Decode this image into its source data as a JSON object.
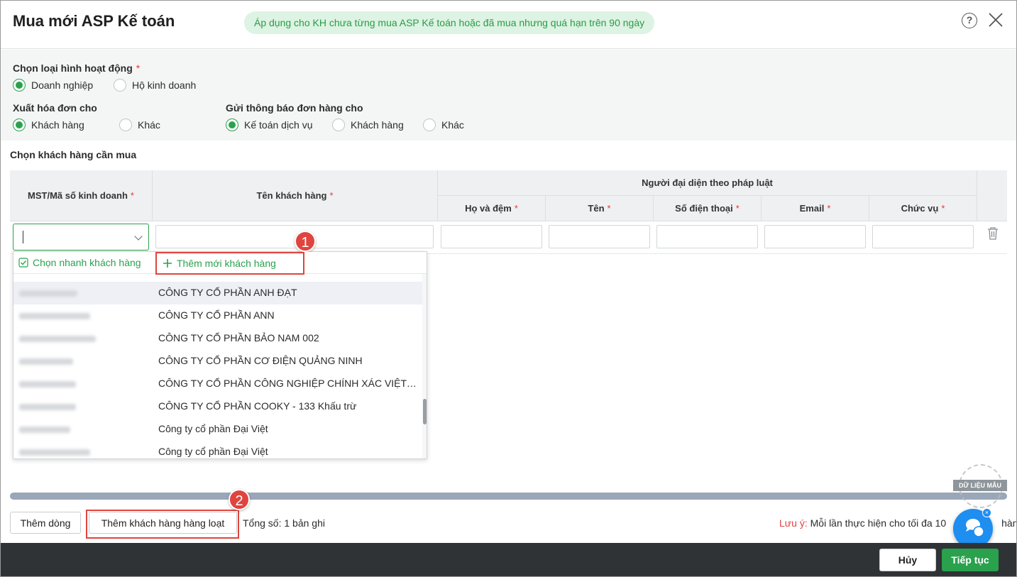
{
  "header": {
    "title": "Mua mới ASP Kế toán",
    "notice": "Áp dụng cho KH chưa từng mua ASP Kế toán hoặc đã mua nhưng quá hạn trên 90 ngày",
    "help_icon": "?"
  },
  "options": {
    "activity_type": {
      "label": "Chọn loại hình hoạt động",
      "required_mark": "*",
      "choices": [
        "Doanh nghiệp",
        "Hộ kinh doanh"
      ],
      "selected": "Doanh nghiệp"
    },
    "invoice_for": {
      "label": "Xuất hóa đơn cho",
      "choices": [
        "Khách hàng",
        "Khác"
      ],
      "selected": "Khách hàng"
    },
    "notify_for": {
      "label": "Gửi thông báo đơn hàng cho",
      "choices": [
        "Kế toán dịch vụ",
        "Khách hàng",
        "Khác"
      ],
      "selected": "Kế toán dịch vụ"
    }
  },
  "customers": {
    "section_title": "Chọn khách hàng cần mua",
    "columns": {
      "mst": "MST/Mã số kinh doanh",
      "name": "Tên khách hàng",
      "representative_group": "Người đại diện theo pháp luật",
      "last_middle": "Họ và đệm",
      "first": "Tên",
      "phone": "Số điện thoại",
      "email": "Email",
      "position": "Chức vụ"
    },
    "required_mark": "*"
  },
  "dropdown": {
    "quick_select": "Chọn nhanh khách hàng",
    "add_new": "Thêm mới khách hàng",
    "items": [
      {
        "name": "CÔNG TY CỔ PHẦN ANH ĐẠT"
      },
      {
        "name": "CÔNG TY CỔ PHẦN ANN"
      },
      {
        "name": "CÔNG TY CỔ PHẦN BẢO NAM 002"
      },
      {
        "name": "CÔNG TY CỔ PHẦN CƠ ĐIỆN QUẢNG NINH"
      },
      {
        "name": "CÔNG TY CỔ PHẦN CÔNG NGHIỆP CHÍNH XÁC VIỆT NAM"
      },
      {
        "name": "CÔNG TY CỔ PHẦN COOKY - 133 Khấu trừ"
      },
      {
        "name": "Công ty cổ phần Đại Việt"
      },
      {
        "name": "Công ty cổ phần Đại Việt"
      }
    ]
  },
  "annotations": {
    "step1": "1",
    "step2": "2"
  },
  "actions": {
    "add_row": "Thêm dòng",
    "bulk_add": "Thêm khách hàng hàng loạt",
    "total": "Tổng số: 1 bản ghi",
    "note_label": "Lưu ý:",
    "note_text": "Mỗi lần thực hiện cho tối đa 10",
    "note_tail": "hàng"
  },
  "watermark": "DỮ LIỆU MẪU",
  "footer": {
    "cancel": "Hủy",
    "next": "Tiếp tục"
  },
  "colors": {
    "accent": "#2aa14d",
    "highlight": "#e0443e",
    "footer": "#2f3336"
  }
}
